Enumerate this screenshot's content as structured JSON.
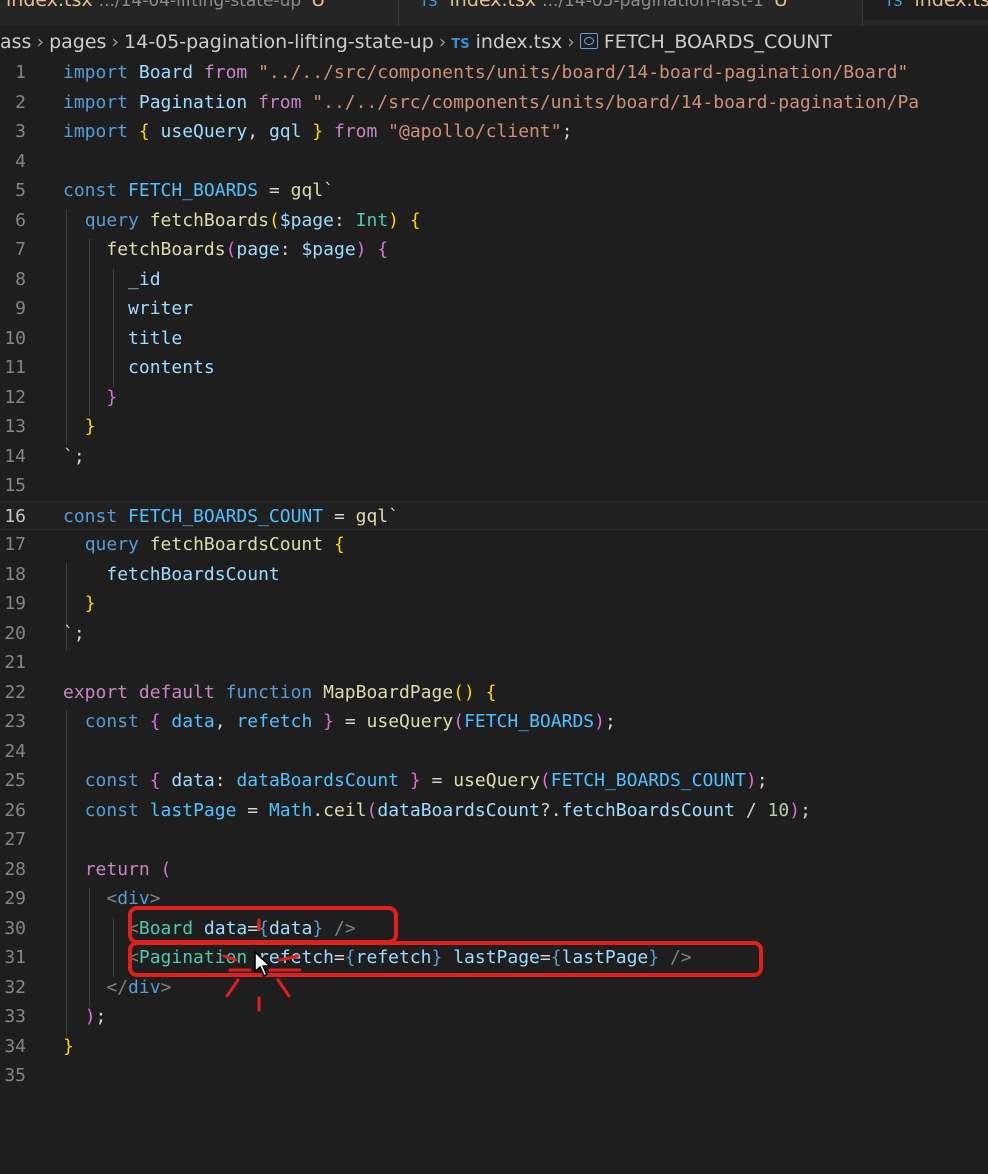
{
  "tabs": [
    {
      "name": "index.tsx",
      "path": ".../14-04-lifting-state-up",
      "badge": "U"
    },
    {
      "name": "index.tsx",
      "path": ".../14-05-pagination-last-1",
      "badge": "U"
    },
    {
      "name": "index.ts",
      "path": "",
      "badge": ""
    }
  ],
  "breadcrumb": {
    "segments": [
      "ass",
      "pages",
      "14-05-pagination-lifting-state-up"
    ],
    "file_icon": "TS",
    "file": "index.tsx",
    "symbol": "FETCH_BOARDS_COUNT"
  },
  "editor": {
    "current_line": 16,
    "lines": [
      {
        "n": "1",
        "t": [
          [
            "k",
            "import "
          ],
          [
            "v",
            "Board "
          ],
          [
            "kc",
            "from "
          ],
          [
            "s",
            "\"../../src/components/units/board/14-board-pagination/Board\""
          ]
        ]
      },
      {
        "n": "2",
        "t": [
          [
            "k",
            "import "
          ],
          [
            "v",
            "Pagination "
          ],
          [
            "kc",
            "from "
          ],
          [
            "s",
            "\"../../src/components/units/board/14-board-pagination/Pa"
          ]
        ]
      },
      {
        "n": "3",
        "t": [
          [
            "k",
            "import "
          ],
          [
            "b1",
            "{ "
          ],
          [
            "v",
            "useQuery"
          ],
          [
            "p",
            ", "
          ],
          [
            "v",
            "gql "
          ],
          [
            "b1",
            "} "
          ],
          [
            "kc",
            "from "
          ],
          [
            "s",
            "\"@apollo/client\""
          ],
          [
            "p",
            ";"
          ]
        ]
      },
      {
        "n": "4",
        "t": []
      },
      {
        "n": "5",
        "t": [
          [
            "k",
            "const "
          ],
          [
            "c",
            "FETCH_BOARDS "
          ],
          [
            "p",
            "= "
          ],
          [
            "f",
            "gql"
          ],
          [
            "gqlt",
            "`"
          ]
        ]
      },
      {
        "n": "6",
        "t": [
          [
            "p",
            "  "
          ],
          [
            "k",
            "query "
          ],
          [
            "f",
            "fetchBoards"
          ],
          [
            "b1",
            "("
          ],
          [
            "v",
            "$page"
          ],
          [
            "p",
            ": "
          ],
          [
            "t",
            "Int"
          ],
          [
            "b1",
            ") {"
          ]
        ]
      },
      {
        "n": "7",
        "t": [
          [
            "p",
            "    "
          ],
          [
            "f",
            "fetchBoards"
          ],
          [
            "b2",
            "("
          ],
          [
            "v",
            "page"
          ],
          [
            "p",
            ": "
          ],
          [
            "v",
            "$page"
          ],
          [
            "b2",
            ") {"
          ]
        ]
      },
      {
        "n": "8",
        "t": [
          [
            "p",
            "      "
          ],
          [
            "v",
            "_id"
          ]
        ]
      },
      {
        "n": "9",
        "t": [
          [
            "p",
            "      "
          ],
          [
            "v",
            "writer"
          ]
        ]
      },
      {
        "n": "10",
        "t": [
          [
            "p",
            "      "
          ],
          [
            "v",
            "title"
          ]
        ]
      },
      {
        "n": "11",
        "t": [
          [
            "p",
            "      "
          ],
          [
            "v",
            "contents"
          ]
        ]
      },
      {
        "n": "12",
        "t": [
          [
            "p",
            "    "
          ],
          [
            "b2",
            "}"
          ]
        ]
      },
      {
        "n": "13",
        "t": [
          [
            "p",
            "  "
          ],
          [
            "b1",
            "}"
          ]
        ]
      },
      {
        "n": "14",
        "t": [
          [
            "gqlt",
            "`"
          ],
          [
            "p",
            ";"
          ]
        ]
      },
      {
        "n": "15",
        "t": []
      },
      {
        "n": "16",
        "t": [
          [
            "k",
            "const "
          ],
          [
            "c",
            "FETCH_BOARDS_COUNT "
          ],
          [
            "p",
            "= "
          ],
          [
            "f",
            "gql"
          ],
          [
            "gqlt",
            "`"
          ]
        ]
      },
      {
        "n": "17",
        "t": [
          [
            "p",
            "  "
          ],
          [
            "k",
            "query "
          ],
          [
            "f",
            "fetchBoardsCount "
          ],
          [
            "b1",
            "{"
          ]
        ]
      },
      {
        "n": "18",
        "t": [
          [
            "p",
            "    "
          ],
          [
            "v",
            "fetchBoardsCount"
          ]
        ]
      },
      {
        "n": "19",
        "t": [
          [
            "p",
            "  "
          ],
          [
            "b1",
            "}"
          ]
        ]
      },
      {
        "n": "20",
        "t": [
          [
            "gqlt",
            "`"
          ],
          [
            "p",
            ";"
          ]
        ]
      },
      {
        "n": "21",
        "t": []
      },
      {
        "n": "22",
        "t": [
          [
            "kc",
            "export "
          ],
          [
            "kc",
            "default "
          ],
          [
            "k",
            "function "
          ],
          [
            "f",
            "MapBoardPage"
          ],
          [
            "b1",
            "() {"
          ]
        ]
      },
      {
        "n": "23",
        "t": [
          [
            "p",
            "  "
          ],
          [
            "k",
            "const "
          ],
          [
            "b2",
            "{ "
          ],
          [
            "c",
            "data"
          ],
          [
            "p",
            ", "
          ],
          [
            "c",
            "refetch "
          ],
          [
            "b2",
            "} "
          ],
          [
            "p",
            "= "
          ],
          [
            "f",
            "useQuery"
          ],
          [
            "b2",
            "("
          ],
          [
            "c",
            "FETCH_BOARDS"
          ],
          [
            "b2",
            ")"
          ],
          [
            "p",
            ";"
          ]
        ]
      },
      {
        "n": "24",
        "t": []
      },
      {
        "n": "25",
        "t": [
          [
            "p",
            "  "
          ],
          [
            "k",
            "const "
          ],
          [
            "b2",
            "{ "
          ],
          [
            "v",
            "data"
          ],
          [
            "p",
            ": "
          ],
          [
            "c",
            "dataBoardsCount "
          ],
          [
            "b2",
            "} "
          ],
          [
            "p",
            "= "
          ],
          [
            "f",
            "useQuery"
          ],
          [
            "b2",
            "("
          ],
          [
            "c",
            "FETCH_BOARDS_COUNT"
          ],
          [
            "b2",
            ")"
          ],
          [
            "p",
            ";"
          ]
        ]
      },
      {
        "n": "26",
        "t": [
          [
            "p",
            "  "
          ],
          [
            "k",
            "const "
          ],
          [
            "c",
            "lastPage "
          ],
          [
            "p",
            "= "
          ],
          [
            "c",
            "Math"
          ],
          [
            "p",
            "."
          ],
          [
            "f",
            "ceil"
          ],
          [
            "b2",
            "("
          ],
          [
            "v",
            "dataBoardsCount"
          ],
          [
            "p",
            "?."
          ],
          [
            "v",
            "fetchBoardsCount "
          ],
          [
            "p",
            "/ "
          ],
          [
            "n",
            "10"
          ],
          [
            "b2",
            ")"
          ],
          [
            "p",
            ";"
          ]
        ]
      },
      {
        "n": "27",
        "t": []
      },
      {
        "n": "28",
        "t": [
          [
            "p",
            "  "
          ],
          [
            "kc",
            "return "
          ],
          [
            "b2",
            "("
          ]
        ]
      },
      {
        "n": "29",
        "t": [
          [
            "p",
            "    "
          ],
          [
            "tg",
            "<"
          ],
          [
            "k",
            "div"
          ],
          [
            "tg",
            ">"
          ]
        ]
      },
      {
        "n": "30",
        "t": [
          [
            "p",
            "      "
          ],
          [
            "tg",
            "<"
          ],
          [
            "t",
            "Board "
          ],
          [
            "v",
            "data"
          ],
          [
            "p",
            "="
          ],
          [
            "k",
            "{"
          ],
          [
            "v",
            "data"
          ],
          [
            "k",
            "}"
          ],
          [
            "tg",
            " />"
          ]
        ]
      },
      {
        "n": "31",
        "t": [
          [
            "p",
            "      "
          ],
          [
            "tg",
            "<"
          ],
          [
            "t",
            "Pagination "
          ],
          [
            "v",
            "refetch"
          ],
          [
            "p",
            "="
          ],
          [
            "k",
            "{"
          ],
          [
            "v",
            "refetch"
          ],
          [
            "k",
            "} "
          ],
          [
            "v",
            "lastPage"
          ],
          [
            "p",
            "="
          ],
          [
            "k",
            "{"
          ],
          [
            "v",
            "lastPage"
          ],
          [
            "k",
            "}"
          ],
          [
            "tg",
            " />"
          ]
        ]
      },
      {
        "n": "32",
        "t": [
          [
            "p",
            "    "
          ],
          [
            "tg",
            "</"
          ],
          [
            "k",
            "div"
          ],
          [
            "tg",
            ">"
          ]
        ]
      },
      {
        "n": "33",
        "t": [
          [
            "p",
            "  "
          ],
          [
            "b2",
            ")"
          ],
          [
            "p",
            ";"
          ]
        ]
      },
      {
        "n": "34",
        "t": [
          [
            "b1",
            "}"
          ]
        ]
      },
      {
        "n": "35",
        "t": []
      }
    ]
  },
  "annotation_color": "#e0201c"
}
